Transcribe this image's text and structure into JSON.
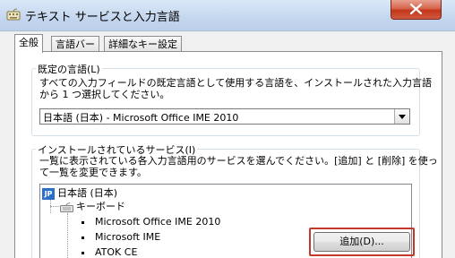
{
  "window": {
    "title": "テキスト サービスと入力言語"
  },
  "tabs": [
    {
      "label": "全般",
      "active": true
    },
    {
      "label": "言語バー",
      "active": false
    },
    {
      "label": "詳細なキー設定",
      "active": false
    }
  ],
  "default_language": {
    "group_title": "既定の言語(L)",
    "description_line1": "すべての入力フィールドの既定言語として使用する言語を、インストールされた入力言語",
    "description_line2": "から 1 つ選択してください。",
    "selected_value": "日本語 (日本) - Microsoft Office IME 2010"
  },
  "installed_services": {
    "group_title": "インストールされているサービス(I)",
    "description_line1": "一覧に表示されている各入力言語用のサービスを選んでください。[追加] と [削除] を使っ",
    "description_line2": "て一覧を変更できます。",
    "tree": {
      "language_badge": "JP",
      "language": "日本語 (日本)",
      "category": "キーボード",
      "items": [
        "Microsoft Office IME 2010",
        "Microsoft IME",
        "ATOK CE"
      ]
    },
    "add_button_label": "追加(D)..."
  },
  "colors": {
    "highlight": "#c0392b",
    "close_button": "#c4371b",
    "badge": "#2d6fc8"
  }
}
